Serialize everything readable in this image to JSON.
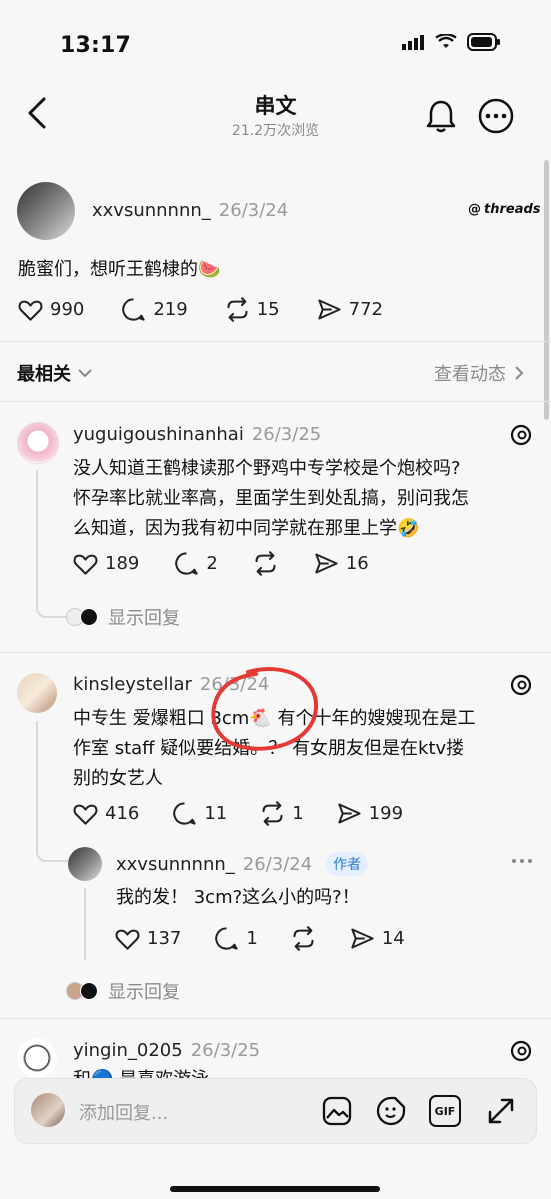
{
  "status": {
    "time": "13:17"
  },
  "header": {
    "title": "串文",
    "subtitle": "21.2万次浏览"
  },
  "post": {
    "username": "xxvsunnnnn_",
    "date": "26/3/24",
    "brand": "threads",
    "text": "脆蜜们，想听王鹤棣的🍉",
    "likes": "990",
    "comments": "219",
    "reposts": "15",
    "shares": "772"
  },
  "sort": {
    "label": "最相关",
    "activity": "查看动态"
  },
  "comments": [
    {
      "username": "yuguigoushinanhai",
      "date": "26/3/25",
      "text_lines": [
        "没人知道王鹤棣读那个野鸡中专学校是个炮校吗?",
        "怀孕率比就业率高，里面学生到处乱搞，别问我怎",
        "么知道，因为我有初中同学就在那里上学🤣"
      ],
      "likes": "189",
      "comments": "2",
      "shares": "16",
      "show_replies": "显示回复"
    },
    {
      "username": "kinsleystellar",
      "date": "26/3/24",
      "text_lines": [
        "中专生 爱爆粗口 3cm🐔 有个十年的嫂嫂现在是工",
        "作室 staff 疑似要结婚。？ 有女朋友但是在ktv搂",
        "别的女艺人"
      ],
      "likes": "416",
      "comments": "11",
      "reposts": "1",
      "shares": "199",
      "reply": {
        "username": "xxvsunnnnn_",
        "date": "26/3/24",
        "badge": "作者",
        "text": "我的发！ 3cm?这么小的吗?！",
        "likes": "137",
        "comments": "1",
        "shares": "14"
      },
      "show_replies": "显示回复"
    },
    {
      "username": "yingin_0205",
      "date": "26/3/25",
      "text_partial": "和🔵 是喜欢游泳"
    }
  ],
  "composer": {
    "placeholder": "添加回复...",
    "gif": "GIF"
  },
  "icons": [
    "back-icon",
    "bell-icon",
    "more-icon",
    "heart-icon",
    "comment-icon",
    "repost-icon",
    "share-icon",
    "threads-icon",
    "chevron-right-icon",
    "chevron-down-icon",
    "image-icon",
    "sticker-icon",
    "gif-icon",
    "expand-icon"
  ],
  "colors": {
    "accent": "#2c7bd1",
    "annotation": "#e53935"
  }
}
